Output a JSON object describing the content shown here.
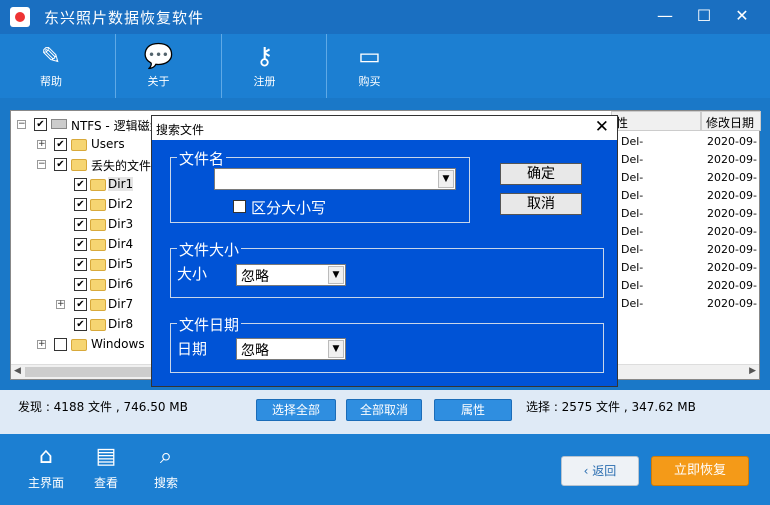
{
  "window": {
    "title": "东兴照片数据恢复软件",
    "minimize": "—",
    "maximize": "☐",
    "close": "✕"
  },
  "toolbar": [
    {
      "label": "帮助",
      "icon": "pen-icon"
    },
    {
      "label": "关于",
      "icon": "chat-bubbles-icon"
    },
    {
      "label": "注册",
      "icon": "key-icon"
    },
    {
      "label": "购买",
      "icon": "card-icon"
    }
  ],
  "tree": {
    "root": "NTFS - 逻辑磁盘",
    "items": [
      "Users",
      "丢失的文件(",
      "Dir1",
      "Dir2",
      "Dir3",
      "Dir4",
      "Dir5",
      "Dir6",
      "Dir7",
      "Dir8",
      "Windows"
    ]
  },
  "grid": {
    "col_attr": "性",
    "col_date": "修改日期",
    "attr_values": [
      "Del-",
      "Del-",
      "Del-",
      "Del-",
      "Del-",
      "Del-",
      "Del-",
      "Del-",
      "Del-",
      "Del-"
    ],
    "date_values": [
      "2020-09-",
      "2020-09-",
      "2020-09-",
      "2020-09-",
      "2020-09-",
      "2020-09-",
      "2020-09-",
      "2020-09-",
      "2020-09-",
      "2020-09-"
    ]
  },
  "status": {
    "found": "发现 : 4188 文件 , 746.50 MB",
    "select_all": "选择全部",
    "deselect_all": "全部取消",
    "properties": "属性",
    "selected": "选择 : 2575 文件 , 347.62 MB"
  },
  "bottom": {
    "home": "主界面",
    "view": "查看",
    "search": "搜索",
    "back": "返回",
    "recover": "立即恢复"
  },
  "dialog": {
    "title": "搜索文件",
    "close": "✕",
    "filename_group": "文件名",
    "filename_value": "",
    "case_sensitive": "区分大小写",
    "ok": "确定",
    "cancel": "取消",
    "size_group": "文件大小",
    "size_label": "大小",
    "size_value": "忽略",
    "date_group": "文件日期",
    "date_label": "日期",
    "date_value": "忽略"
  }
}
